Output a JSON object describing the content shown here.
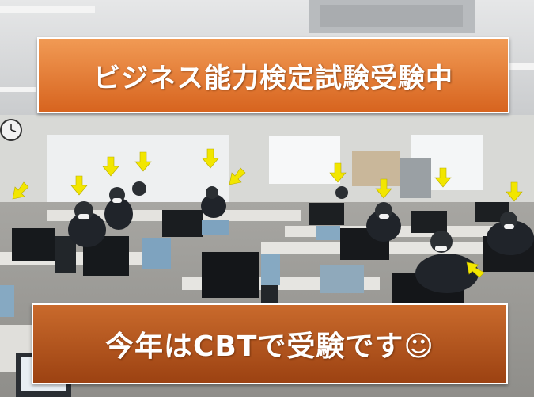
{
  "top_banner": {
    "text": "ビジネス能力検定試験受験中"
  },
  "bottom_banner": {
    "text": "今年はCBTで受験です☺"
  },
  "colors": {
    "banner_top": "#e87d3a",
    "banner_bottom": "#b9521a",
    "arrow": "#f2e600"
  },
  "icons": {
    "arrow": "yellow-arrow-icon"
  }
}
